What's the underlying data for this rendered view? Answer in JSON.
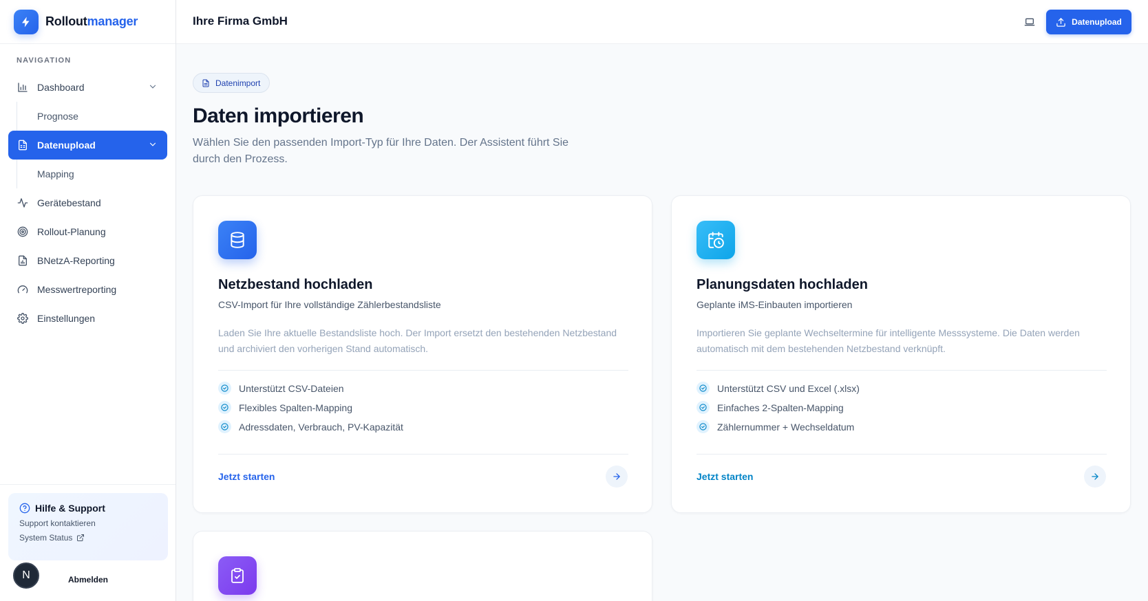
{
  "brand": {
    "name_part1": "Rollout",
    "name_part2": "manager"
  },
  "colors": {
    "primary": "#2563eb",
    "sky": "#0ea5e9",
    "purple": "#7c3aed"
  },
  "sidebar": {
    "heading": "NAVIGATION",
    "items": [
      {
        "label": "Dashboard",
        "icon": "bar-chart-icon"
      },
      {
        "label": "Prognose"
      },
      {
        "label": "Datenupload",
        "icon": "spreadsheet-icon",
        "active": true
      },
      {
        "label": "Mapping"
      },
      {
        "label": "Gerätebestand",
        "icon": "activity-icon"
      },
      {
        "label": "Rollout-Planung",
        "icon": "target-icon"
      },
      {
        "label": "BNetzA-Reporting",
        "icon": "report-file-icon"
      },
      {
        "label": "Messwertreporting",
        "icon": "gauge-icon"
      },
      {
        "label": "Einstellungen",
        "icon": "gear-icon"
      }
    ],
    "help": {
      "title": "Hilfe & Support",
      "contact": "Support kontaktieren",
      "status": "System Status"
    },
    "avatar_initial": "N",
    "logout": "Abmelden"
  },
  "header": {
    "company": "Ihre Firma GmbH",
    "upload_label": "Datenupload"
  },
  "main": {
    "badge": "Datenimport",
    "title": "Daten importieren",
    "description": "Wählen Sie den passenden Import-Typ für Ihre Daten. Der Assistent führt Sie durch den Prozess.",
    "cards": [
      {
        "title": "Netzbestand hochladen",
        "subtitle": "CSV-Import für Ihre vollständige Zählerbestandsliste",
        "description": "Laden Sie Ihre aktuelle Bestandsliste hoch. Der Import ersetzt den bestehenden Netzbestand und archiviert den vorherigen Stand automatisch.",
        "features": [
          "Unterstützt CSV-Dateien",
          "Flexibles Spalten-Mapping",
          "Adressdaten, Verbrauch, PV-Kapazität"
        ],
        "cta": "Jetzt starten",
        "icon": "database-icon"
      },
      {
        "title": "Planungsdaten hochladen",
        "subtitle": "Geplante iMS-Einbauten importieren",
        "description": "Importieren Sie geplante Wechseltermine für intelligente Messsysteme. Die Daten werden automatisch mit dem bestehenden Netzbestand verknüpft.",
        "features": [
          "Unterstützt CSV und Excel (.xlsx)",
          "Einfaches 2-Spalten-Mapping",
          "Zählernummer + Wechseldatum"
        ],
        "cta": "Jetzt starten",
        "icon": "calendar-clock-icon"
      },
      {
        "icon": "clipboard-check-icon"
      }
    ]
  }
}
